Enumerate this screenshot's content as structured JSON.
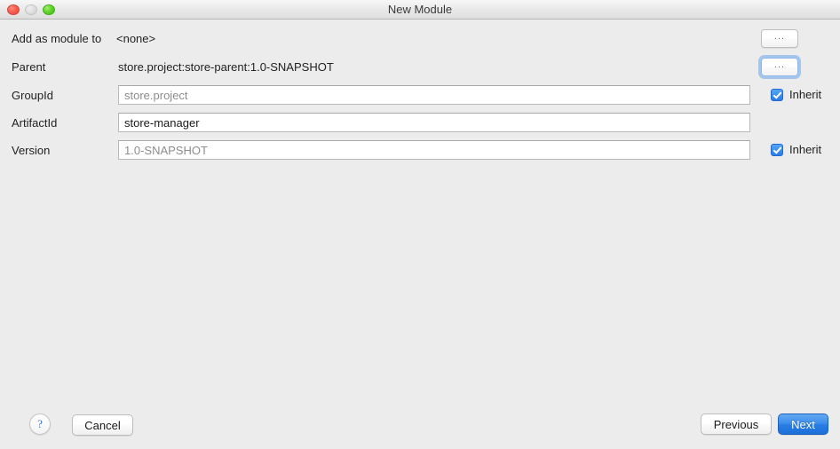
{
  "window": {
    "title": "New Module",
    "traffic_lights": [
      {
        "name": "close",
        "color": "#fa5e52"
      },
      {
        "name": "minimize",
        "color": "#dcdcdc"
      },
      {
        "name": "maximize",
        "color": "#5fd42b"
      }
    ]
  },
  "form": {
    "rows": {
      "add_as_module_to": {
        "label": "Add as module to",
        "value": "<none>",
        "browse_button": "..."
      },
      "parent": {
        "label": "Parent",
        "value": "store.project:store-parent:1.0-SNAPSHOT",
        "browse_button": "..."
      },
      "group_id": {
        "label": "GroupId",
        "value": "store.project",
        "inherit_label": "Inherit",
        "inherit_checked": true
      },
      "artifact_id": {
        "label": "ArtifactId",
        "value": "store-manager"
      },
      "version": {
        "label": "Version",
        "value": "1.0-SNAPSHOT",
        "inherit_label": "Inherit",
        "inherit_checked": true
      }
    }
  },
  "footer": {
    "help_label": "?",
    "cancel_label": "Cancel",
    "previous_label": "Previous",
    "next_label": "Next"
  },
  "colors": {
    "window_background": "#ececec",
    "accent_blue": "#2a7de8",
    "primary_button": "#1d6fd8",
    "field_border": "#b9b9b9",
    "dim_text": "#8d8d8d"
  }
}
